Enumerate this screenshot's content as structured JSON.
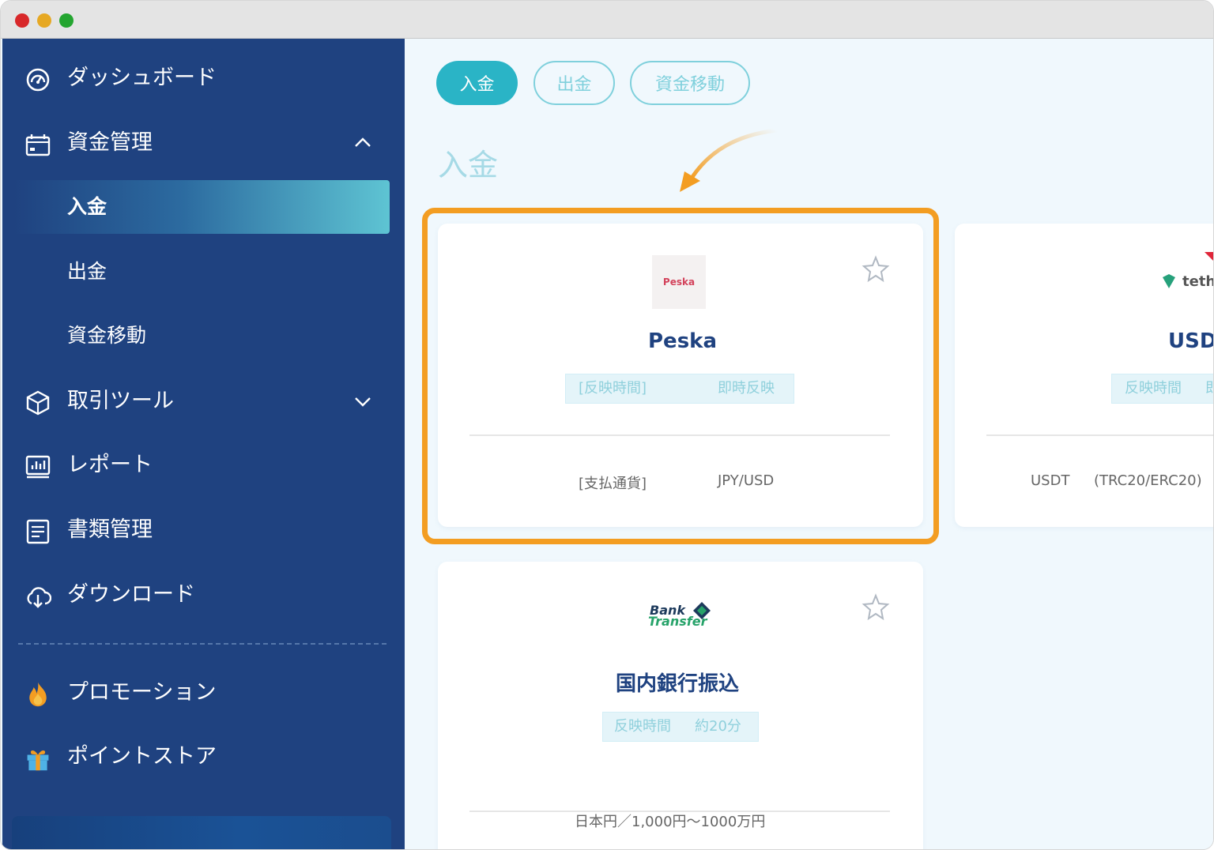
{
  "sidebar": {
    "items": [
      {
        "label": "ダッシュボード",
        "icon": "dashboard-gauge-icon"
      },
      {
        "label": "資金管理",
        "icon": "wallet-icon",
        "chevron": "chevron-up-icon"
      },
      {
        "label": "取引ツール",
        "icon": "cube-icon",
        "chevron": "chevron-down-icon"
      },
      {
        "label": "レポート",
        "icon": "report-chart-icon"
      },
      {
        "label": "書類管理",
        "icon": "document-icon"
      },
      {
        "label": "ダウンロード",
        "icon": "cloud-download-icon"
      },
      {
        "label": "プロモーション",
        "icon": "fire-icon"
      },
      {
        "label": "ポイントストア",
        "icon": "gift-icon"
      }
    ],
    "sub_items": [
      {
        "label": "入金",
        "active": true
      },
      {
        "label": "出金",
        "active": false
      },
      {
        "label": "資金移動",
        "active": false
      }
    ]
  },
  "main": {
    "tabs": [
      {
        "label": "入金",
        "active": true
      },
      {
        "label": "出金",
        "active": false
      },
      {
        "label": "資金移動",
        "active": false
      }
    ],
    "heading": "入金",
    "cards": [
      {
        "title": "Peska",
        "logo_text": "Peska",
        "badge_label": "[反映時間]",
        "badge_value": "即時反映",
        "meta_label": "[支払通貨]",
        "meta_value": "JPY/USD",
        "highlighted": true
      },
      {
        "title": "USD",
        "logo_text": "teth",
        "badge_label": "反映時間",
        "badge_value": "即",
        "meta_label": "USDT",
        "meta_value": "(TRC20/ERC20)"
      },
      {
        "title": "国内銀行振込",
        "logo_text_1": "Bank",
        "logo_text_2": "Transfer",
        "badge_label": "反映時間",
        "badge_value": "約20分",
        "meta_label": "日本円／1,000円～1000万円"
      }
    ]
  },
  "colors": {
    "sidebar_bg": "#1f4280",
    "accent_teal": "#2ab4c6",
    "highlight_orange": "#f39d22",
    "main_bg": "#f0f8fd"
  }
}
